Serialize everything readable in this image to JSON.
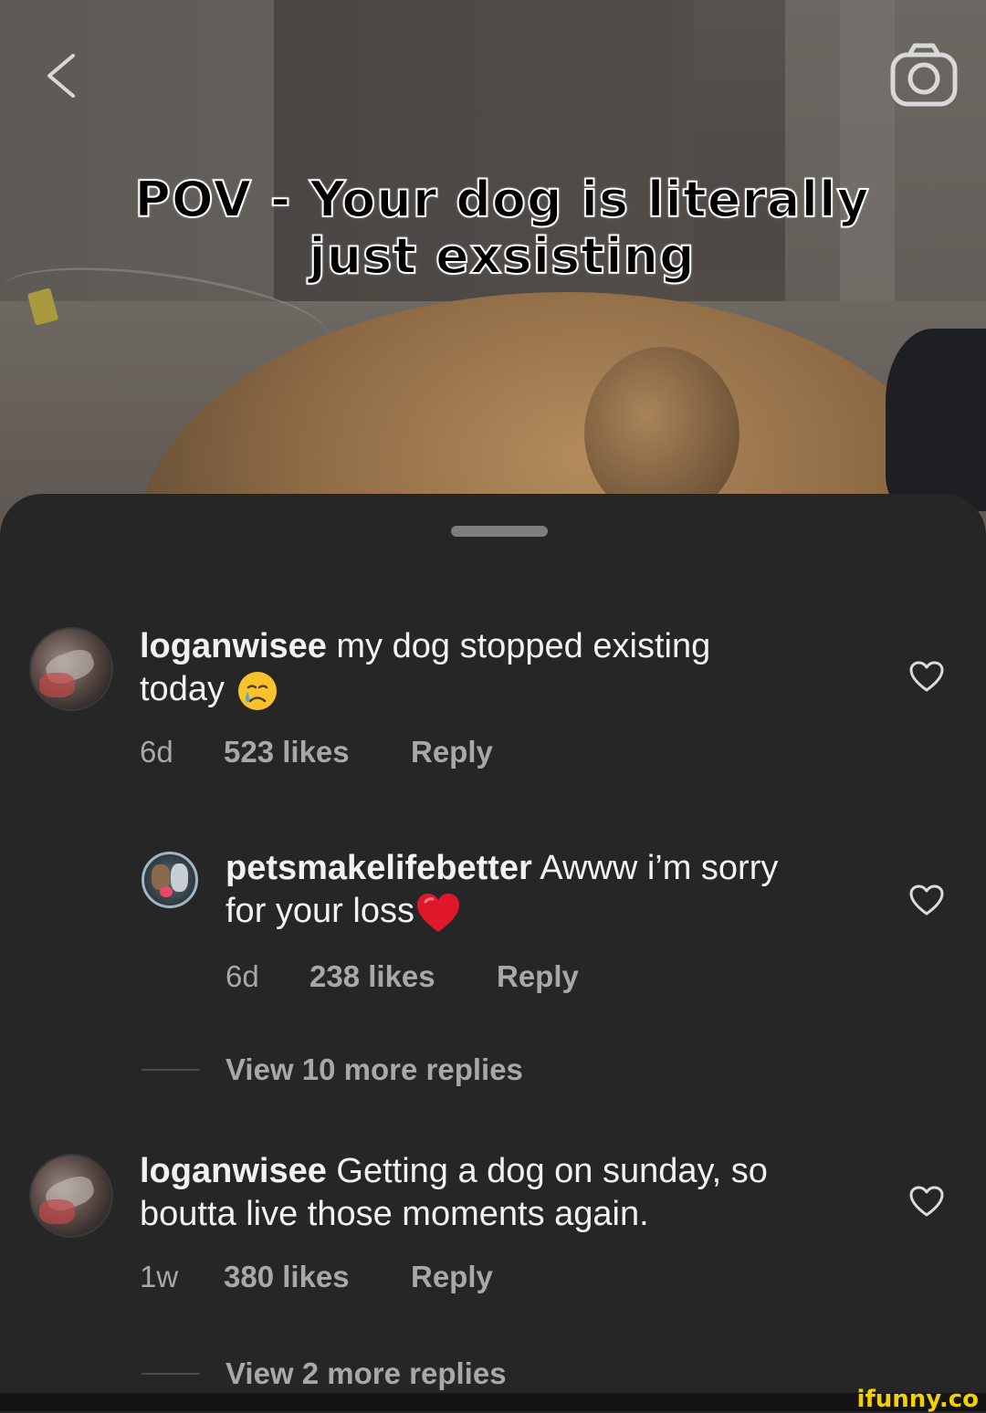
{
  "video": {
    "overlay_line1": "POV - Your dog is literally",
    "overlay_line2": "just exsisting",
    "back_icon": "chevron-left-icon",
    "camera_icon": "camera-icon"
  },
  "comments": [
    {
      "username": "loganwisee",
      "text": "my dog stopped existing",
      "text2": "today",
      "emoji": "crying-face",
      "time": "6d",
      "likes": "523 likes",
      "reply": "Reply"
    },
    {
      "username": "petsmakelifebetter",
      "text": "Awww i’m sorry",
      "text2": "for your loss",
      "emoji": "red-heart",
      "time": "6d",
      "likes": "238 likes",
      "reply": "Reply",
      "view_more": "View 10 more replies"
    },
    {
      "username": "loganwisee",
      "text": "Getting a dog on sunday, so",
      "text2": "boutta live those moments again.",
      "time": "1w",
      "likes": "380 likes",
      "reply": "Reply",
      "view_more": "View 2 more replies"
    }
  ],
  "watermark": "ifunny.co",
  "colors": {
    "sheet_bg": "#262626",
    "muted_text": "#a8a8a8",
    "watermark": "#f5d000"
  }
}
